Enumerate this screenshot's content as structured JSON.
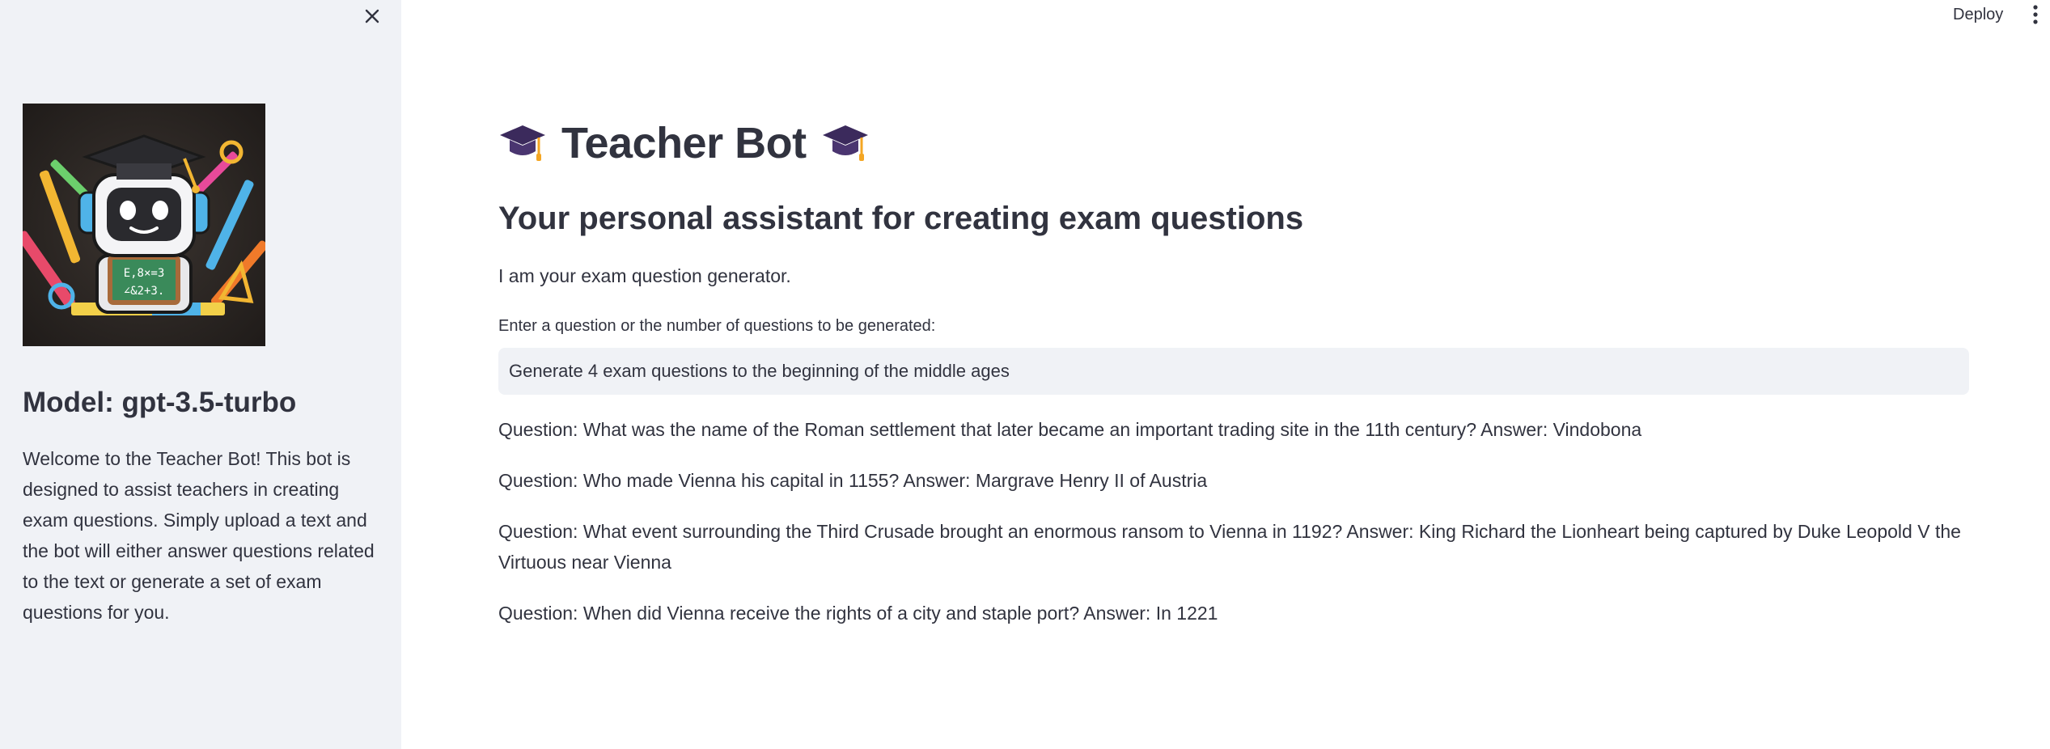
{
  "sidebar": {
    "model_label": "Model: gpt-3.5-turbo",
    "welcome_text": "Welcome to the Teacher Bot! This bot is designed to assist teachers in creating exam questions. Simply upload a text and the bot will either answer questions related to the text or generate a set of exam questions for you.",
    "close_icon": "close-icon",
    "avatar_icon": "robot-teacher-avatar"
  },
  "header": {
    "deploy_label": "Deploy",
    "menu_icon": "kebab-menu-icon"
  },
  "main": {
    "title": "Teacher Bot",
    "title_icon": "graduation-cap-icon",
    "subtitle": "Your personal assistant for creating exam questions",
    "intro": "I am your exam question generator.",
    "input": {
      "label": "Enter a question or the number of questions to be generated:",
      "value": "Generate 4 exam questions to the beginning of the middle ages"
    },
    "answers": [
      "Question: What was the name of the Roman settlement that later became an important trading site in the 11th century? Answer: Vindobona",
      "Question: Who made Vienna his capital in 1155? Answer: Margrave Henry II of Austria",
      "Question: What event surrounding the Third Crusade brought an enormous ransom to Vienna in 1192? Answer: King Richard the Lionheart being captured by Duke Leopold V the Virtuous near Vienna",
      "Question: When did Vienna receive the rights of a city and staple port? Answer: In 1221"
    ]
  },
  "colors": {
    "sidebar_bg": "#f0f2f6",
    "text": "#31333f",
    "input_bg": "#f0f2f6",
    "cap_dark": "#3b2a5c",
    "cap_tassel": "#f4a623"
  }
}
